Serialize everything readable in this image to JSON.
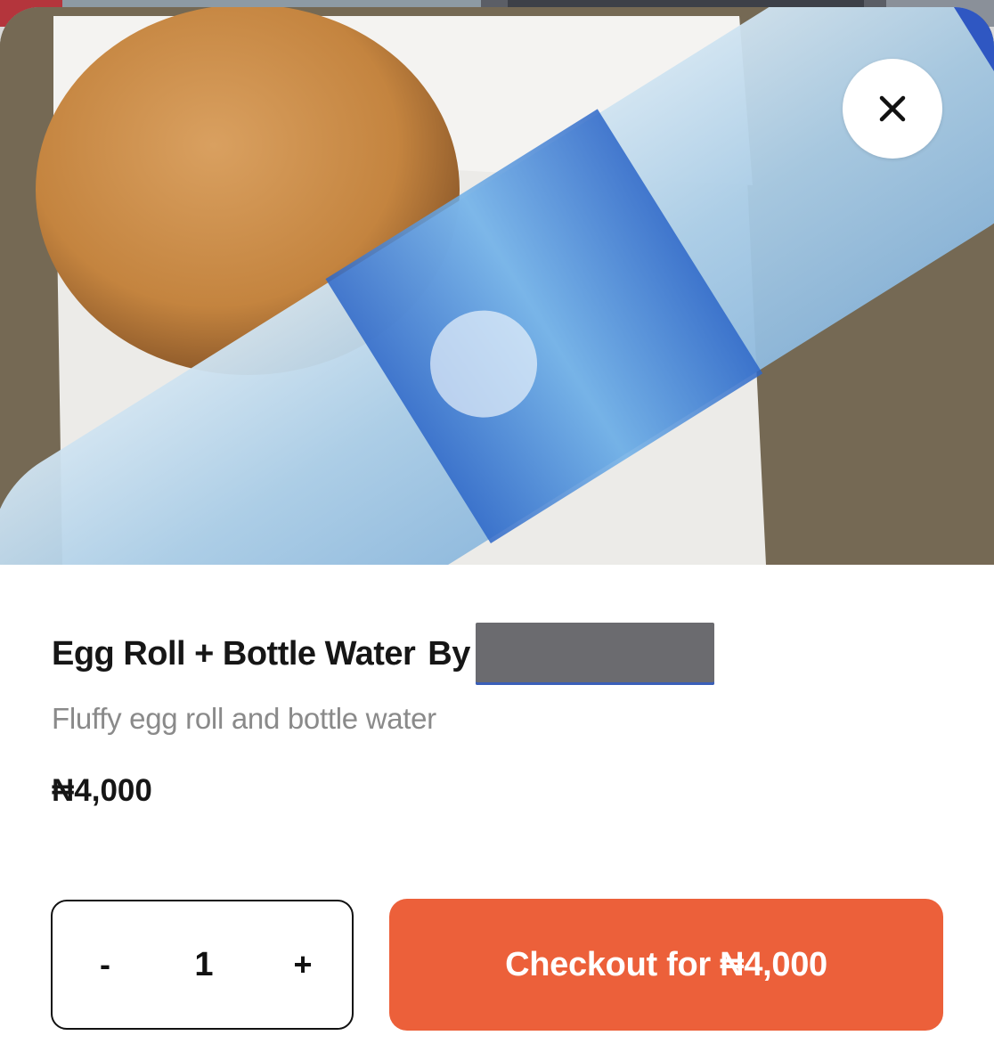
{
  "product": {
    "title": "Egg Roll + Bottle Water",
    "by_label": "By",
    "description": "Fluffy egg roll and  bottle water",
    "price": "₦4,000"
  },
  "quantity": {
    "decrement_label": "-",
    "value": "1",
    "increment_label": "+"
  },
  "checkout": {
    "label": "Checkout for ₦4,000"
  },
  "colors": {
    "accent": "#ec603a",
    "text": "#161616",
    "muted": "#8a8a8a"
  },
  "icons": {
    "close": "close-icon"
  }
}
